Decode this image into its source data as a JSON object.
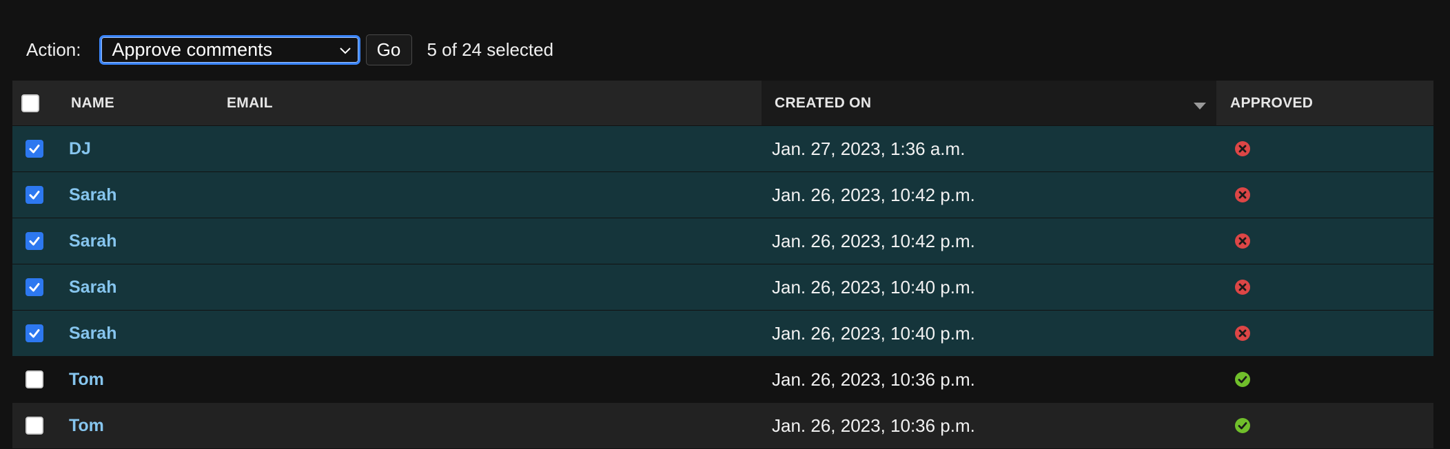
{
  "actions": {
    "label": "Action:",
    "selected_action": "Approve comments",
    "go_label": "Go",
    "selection_counter": "5 of 24 selected"
  },
  "table": {
    "headers": {
      "name": "NAME",
      "email": "EMAIL",
      "created_on": "CREATED ON",
      "approved": "APPROVED"
    },
    "sort_column": "created_on",
    "sort_direction": "descending",
    "rows": [
      {
        "checked": true,
        "name": "DJ",
        "email": "",
        "created_on": "Jan. 27, 2023, 1:36 a.m.",
        "approved": false
      },
      {
        "checked": true,
        "name": "Sarah",
        "email": "",
        "created_on": "Jan. 26, 2023, 10:42 p.m.",
        "approved": false
      },
      {
        "checked": true,
        "name": "Sarah",
        "email": "",
        "created_on": "Jan. 26, 2023, 10:42 p.m.",
        "approved": false
      },
      {
        "checked": true,
        "name": "Sarah",
        "email": "",
        "created_on": "Jan. 26, 2023, 10:40 p.m.",
        "approved": false
      },
      {
        "checked": true,
        "name": "Sarah",
        "email": "",
        "created_on": "Jan. 26, 2023, 10:40 p.m.",
        "approved": false
      },
      {
        "checked": false,
        "name": "Tom",
        "email": "",
        "created_on": "Jan. 26, 2023, 10:36 p.m.",
        "approved": true
      },
      {
        "checked": false,
        "name": "Tom",
        "email": "",
        "created_on": "Jan. 26, 2023, 10:36 p.m.",
        "approved": true
      }
    ]
  },
  "icons": {
    "checked": "checkmark-icon",
    "approved_yes": "check-circle-icon",
    "approved_no": "x-circle-icon",
    "dropdown": "chevron-down-icon",
    "sort": "sort-descending-icon"
  },
  "colors": {
    "selected_row": "#15353b",
    "link": "#86c5ee",
    "approved_yes": "#70bf2b",
    "approved_no": "#dd4646",
    "focus_ring": "#3b86ff"
  }
}
